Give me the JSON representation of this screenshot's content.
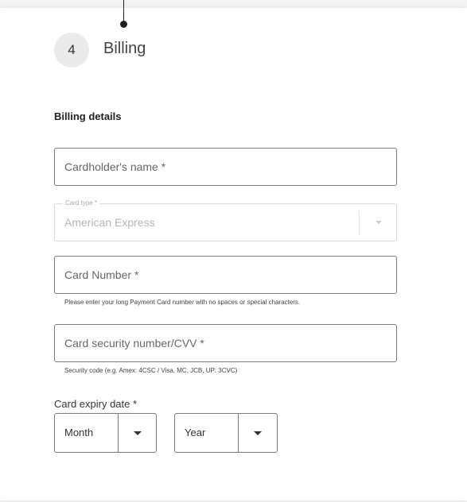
{
  "step": {
    "number": "4",
    "title": "Billing"
  },
  "billing": {
    "section_title": "Billing details",
    "cardholder_name": {
      "placeholder": "Cardholder's name *",
      "value": ""
    },
    "card_type": {
      "label": "Card type *",
      "value": "American Express",
      "disabled": true
    },
    "card_number": {
      "placeholder": "Card Number *",
      "value": "",
      "help": "Please enter your long Payment Card number with no spaces or special characters."
    },
    "cvv": {
      "placeholder": "Card security number/CVV *",
      "value": "",
      "help": "Security code (e.g. Amex: 4CSC / Visa, MC, JCB, UP: 3CVC)"
    },
    "expiry": {
      "label": "Card expiry date *",
      "month": "Month",
      "year": "Year"
    }
  },
  "icons": {
    "dropdown": "chevron-down-icon"
  },
  "colors": {
    "border": "#7a7a7a",
    "disabled_border": "#dadada",
    "step_circle": "#ebebeb"
  }
}
